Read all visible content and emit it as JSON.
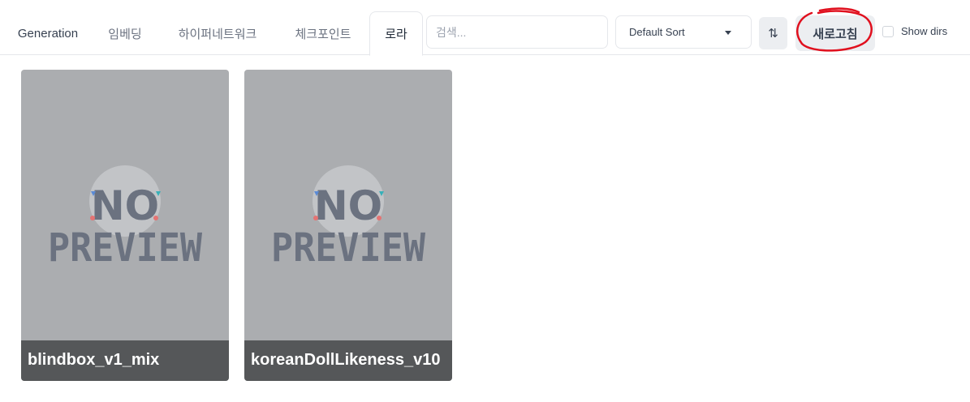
{
  "tabs": [
    {
      "label": "Generation"
    },
    {
      "label": "임베딩"
    },
    {
      "label": "하이퍼네트워크"
    },
    {
      "label": "체크포인트"
    },
    {
      "label": "로라",
      "active": true
    }
  ],
  "search": {
    "placeholder": "검색..."
  },
  "sort": {
    "selected": "Default Sort"
  },
  "sort_direction_icon": "swap-vertical-icon",
  "refresh": {
    "label": "새로고침"
  },
  "show_dirs": {
    "label": "Show dirs",
    "checked": false
  },
  "cards": [
    {
      "name": "blindbox_v1_mix",
      "preview_text": [
        "NO",
        "PREVIEW"
      ]
    },
    {
      "name": "koreanDollLikeness_v10",
      "preview_text": [
        "NO",
        "PREVIEW"
      ]
    }
  ],
  "colors": {
    "annotation": "#e0101e",
    "card_bg": "#abadb0",
    "placeholder_ink": "#6b7280"
  }
}
